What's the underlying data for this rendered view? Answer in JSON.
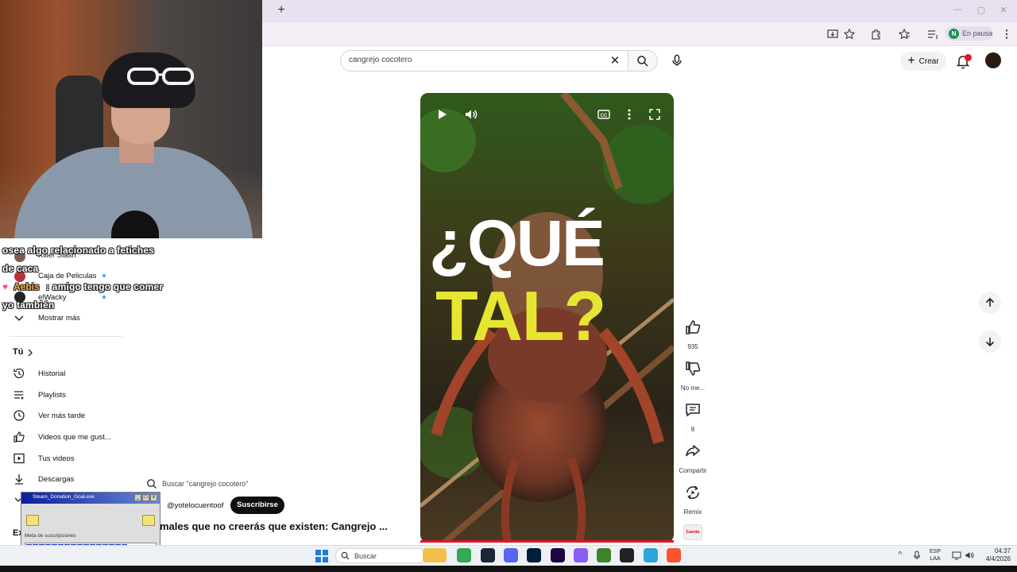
{
  "browser": {
    "new_tab": "+",
    "profile_initial": "N",
    "profile_status": "En pausa",
    "window_controls": [
      "—",
      "▢",
      "✕"
    ]
  },
  "youtube_header": {
    "search_value": "cangrejo cocotero",
    "create_label": "Crear",
    "notification_count": "1"
  },
  "chat": {
    "line1": "osea algo relacionado a fetiches",
    "line2": "de caca",
    "user": "Aebis",
    "line3_msg": ": amigo tengo que comer",
    "line4": "yo también"
  },
  "sidebar": {
    "subscriptions": [
      {
        "label": "Killer Slash",
        "color": "#7d5e4c"
      },
      {
        "label": "Caja de Peliculas",
        "color": "#b5323a"
      },
      {
        "label": "elWacky",
        "color": "#222222"
      }
    ],
    "show_more": "Mostrar más",
    "you_heading": "Tú",
    "you_items": [
      {
        "label": "Historial",
        "icon": "history-icon"
      },
      {
        "label": "Playlists",
        "icon": "playlists-icon"
      },
      {
        "label": "Ver más tarde",
        "icon": "watch-later-icon"
      },
      {
        "label": "Videos que me gust...",
        "icon": "liked-icon"
      },
      {
        "label": "Tus videos",
        "icon": "your-videos-icon"
      },
      {
        "label": "Descargas",
        "icon": "downloads-icon"
      }
    ],
    "explore_partial": "Ex"
  },
  "video": {
    "overlay_line1": "¿QUÉ",
    "overlay_line2": "TAL?",
    "progress": 1.0
  },
  "actions": {
    "likes": "935",
    "dislike_label": "No me...",
    "comments": "8",
    "share_label": "Compartir",
    "remix_label": "Remix",
    "channel_thumb_text": "Cuento"
  },
  "below_video": {
    "search_suggestion": "Buscar \"cangrejo cocotero\"",
    "channel_handle": "@yotelocuentoof",
    "subscribe_label": "Suscribirse",
    "title": "males que no creerás que existen: Cangrejo ..."
  },
  "donation_widget": {
    "title": "Steam_Donation_Goal.exe",
    "label": "Meta de suscripciones",
    "progress": 0.8
  },
  "taskbar": {
    "search_placeholder": "Buscar",
    "language": "ESP",
    "layout": "LAA",
    "time": "04:37",
    "date": "4/4/2026",
    "apps": [
      {
        "name": "file-explorer-icon",
        "color": "#f2c14b"
      },
      {
        "name": "chrome-icon",
        "color": "#34a853"
      },
      {
        "name": "steam-icon",
        "color": "#1b2838"
      },
      {
        "name": "discord-icon",
        "color": "#5865f2"
      },
      {
        "name": "photoshop-icon",
        "color": "#001e36"
      },
      {
        "name": "premiere-icon",
        "color": "#1f0740"
      },
      {
        "name": "obs-icon",
        "color": "#8b5cf6"
      },
      {
        "name": "minecraft-icon",
        "color": "#3c8527"
      },
      {
        "name": "media-icon",
        "color": "#222222"
      },
      {
        "name": "edge-icon",
        "color": "#2fa4d8"
      },
      {
        "name": "brave-icon",
        "color": "#fb542b"
      }
    ]
  },
  "colors": {
    "accent_red": "#e0162b",
    "caption_yellow": "#e6e632",
    "subscribe_black": "#0f0f0f"
  }
}
